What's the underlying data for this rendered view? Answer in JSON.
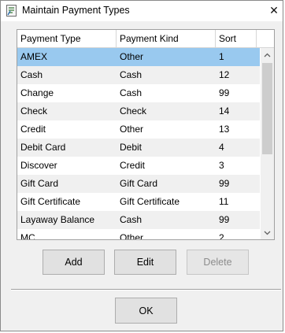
{
  "window": {
    "title": "Maintain Payment Types",
    "close_glyph": "✕"
  },
  "grid": {
    "columns": [
      "Payment Type",
      "Payment Kind",
      "Sort"
    ],
    "rows": [
      {
        "type": "AMEX",
        "kind": "Other",
        "sort": "1"
      },
      {
        "type": "Cash",
        "kind": "Cash",
        "sort": "12"
      },
      {
        "type": "Change",
        "kind": "Cash",
        "sort": "99"
      },
      {
        "type": "Check",
        "kind": "Check",
        "sort": "14"
      },
      {
        "type": "Credit",
        "kind": "Other",
        "sort": "13"
      },
      {
        "type": "Debit Card",
        "kind": "Debit",
        "sort": "4"
      },
      {
        "type": "Discover",
        "kind": "Credit",
        "sort": "3"
      },
      {
        "type": "Gift Card",
        "kind": "Gift Card",
        "sort": "99"
      },
      {
        "type": "Gift Certificate",
        "kind": "Gift Certificate",
        "sort": "11"
      },
      {
        "type": "Layaway Balance",
        "kind": "Cash",
        "sort": "99"
      },
      {
        "type": "MC",
        "kind": "Other",
        "sort": "2"
      }
    ],
    "selected_index": 0
  },
  "buttons": {
    "add": "Add",
    "edit": "Edit",
    "delete": "Delete",
    "ok": "OK"
  },
  "colors": {
    "selected_row": "#99c9ef",
    "alt_row": "#f0f0f0",
    "window_bg": "#f0f0f0"
  },
  "icons": {
    "app": "app-icon",
    "close": "close-icon",
    "scroll_up": "chevron-up-icon",
    "scroll_down": "chevron-down-icon"
  }
}
